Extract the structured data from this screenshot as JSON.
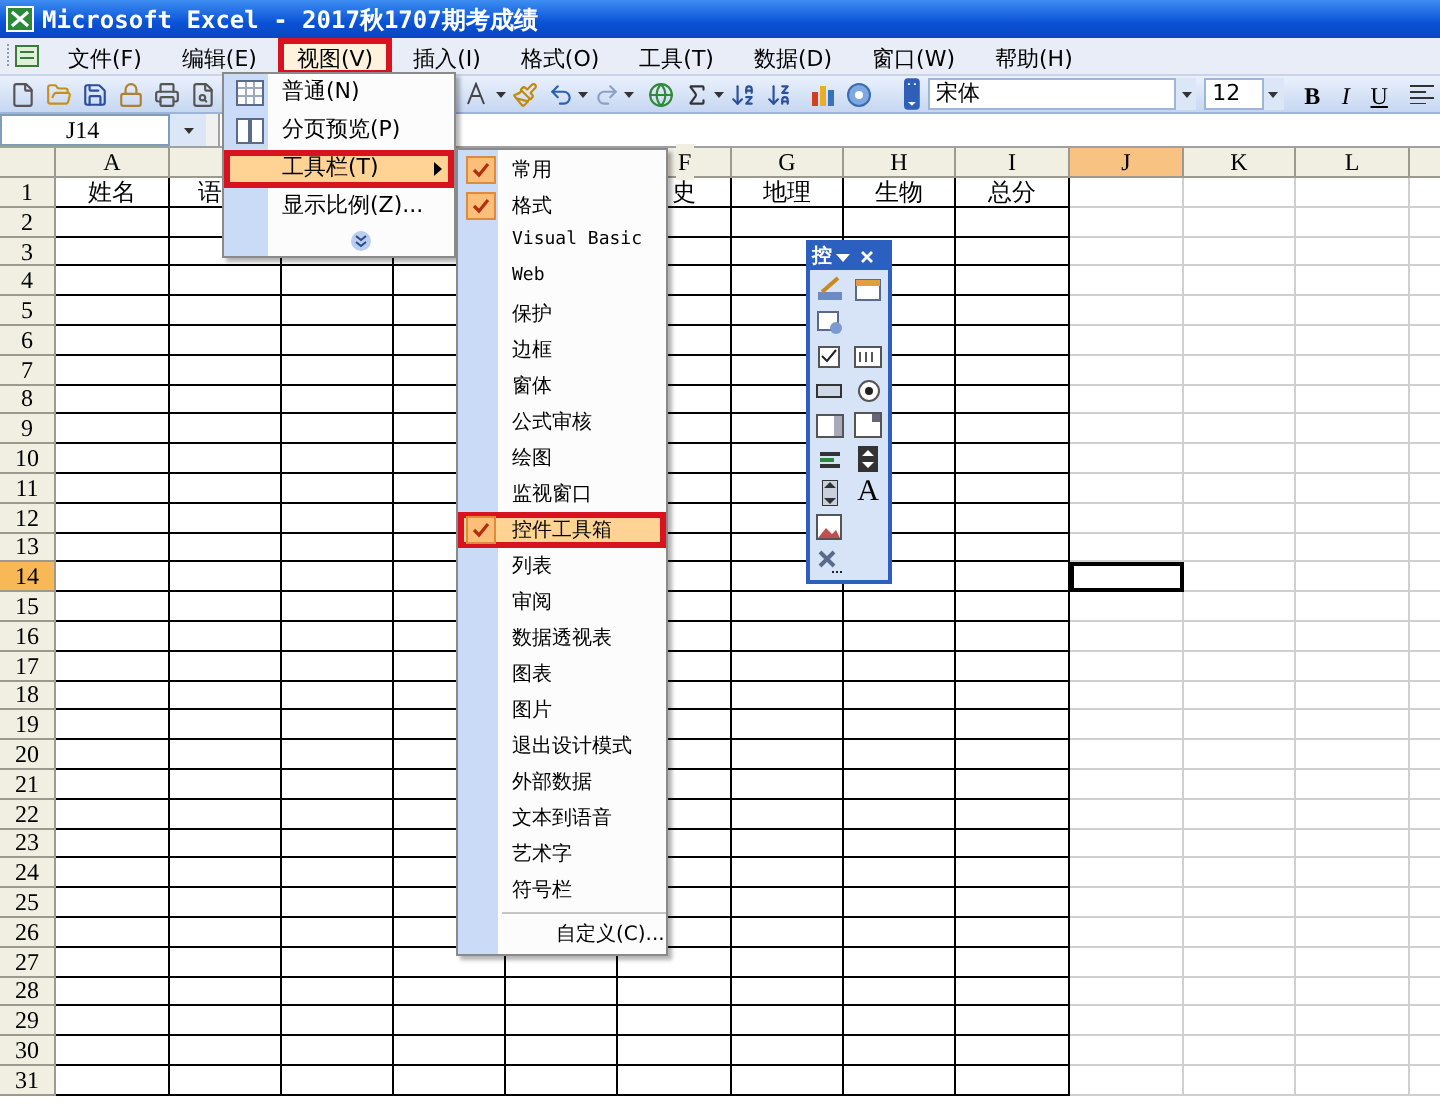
{
  "window": {
    "title": "Microsoft Excel - 2017秋1707期考成绩"
  },
  "menu_bar": [
    {
      "label": "文件(F)",
      "selected": false,
      "annotated": false
    },
    {
      "label": "编辑(E)",
      "selected": false,
      "annotated": false
    },
    {
      "label": "视图(V)",
      "selected": true,
      "annotated": true
    },
    {
      "label": "插入(I)",
      "selected": false,
      "annotated": false
    },
    {
      "label": "格式(O)",
      "selected": false,
      "annotated": false
    },
    {
      "label": "工具(T)",
      "selected": false,
      "annotated": false
    },
    {
      "label": "数据(D)",
      "selected": false,
      "annotated": false
    },
    {
      "label": "窗口(W)",
      "selected": false,
      "annotated": false
    },
    {
      "label": "帮助(H)",
      "selected": false,
      "annotated": false
    }
  ],
  "toolbar": {
    "font": "宋体",
    "font_size": "12",
    "format_buttons": [
      "B",
      "I",
      "U"
    ]
  },
  "name_box": "J14",
  "sheet": {
    "columns": [
      {
        "label": "A",
        "selected": false
      },
      {},
      {},
      {},
      {},
      {
        "label": "F",
        "selected": false
      },
      {
        "label": "G",
        "selected": false
      },
      {
        "label": "H",
        "selected": false
      },
      {
        "label": "I",
        "selected": false
      },
      {
        "label": "J",
        "selected": true
      },
      {
        "label": "K",
        "selected": false
      },
      {
        "label": "L",
        "selected": false
      }
    ],
    "rows": [
      {
        "label": "1",
        "selected": false,
        "cells": [
          {
            "text": "姓名"
          },
          {
            "text": "语"
          },
          null,
          null,
          null,
          {
            "text": "史"
          },
          {
            "text": "地理"
          },
          {
            "text": "生物"
          },
          {
            "text": "总分"
          }
        ]
      },
      {
        "label": "2",
        "selected": false
      },
      {
        "label": "3",
        "selected": false
      },
      {
        "label": "4",
        "selected": false
      },
      {
        "label": "5",
        "selected": false
      },
      {
        "label": "6",
        "selected": false
      },
      {
        "label": "7",
        "selected": false
      },
      {
        "label": "8",
        "selected": false
      },
      {
        "label": "9",
        "selected": false
      },
      {
        "label": "10",
        "selected": false
      },
      {
        "label": "11",
        "selected": false
      },
      {
        "label": "12",
        "selected": false
      },
      {
        "label": "13",
        "selected": false
      },
      {
        "label": "14",
        "selected": true
      },
      {
        "label": "15",
        "selected": false
      },
      {
        "label": "16",
        "selected": false
      },
      {
        "label": "17",
        "selected": false
      },
      {
        "label": "18",
        "selected": false
      },
      {
        "label": "19",
        "selected": false
      },
      {
        "label": "20",
        "selected": false
      },
      {
        "label": "21",
        "selected": false
      },
      {
        "label": "22",
        "selected": false
      },
      {
        "label": "23",
        "selected": false
      },
      {
        "label": "24",
        "selected": false
      },
      {
        "label": "25",
        "selected": false
      },
      {
        "label": "26",
        "selected": false
      },
      {
        "label": "27",
        "selected": false
      },
      {
        "label": "28",
        "selected": false
      },
      {
        "label": "29",
        "selected": false
      },
      {
        "label": "30",
        "selected": false
      },
      {
        "label": "31",
        "selected": false
      }
    ]
  },
  "view_menu": {
    "items": [
      {
        "kind": "item",
        "label": "普通(N)",
        "selected": false,
        "annotated": false
      },
      {
        "kind": "item",
        "label": "分页预览(P)",
        "selected": false,
        "annotated": false
      },
      {
        "kind": "submenu",
        "label": "工具栏(T)",
        "selected": true,
        "annotated": true
      },
      {
        "kind": "item",
        "label": "显示比例(Z)...",
        "selected": false,
        "annotated": false
      },
      {
        "kind": "expand"
      }
    ]
  },
  "toolbars_submenu": {
    "items": [
      {
        "kind": "toggle",
        "label": "常用",
        "checked": true,
        "selected": false,
        "annotated": false
      },
      {
        "kind": "toggle",
        "label": "格式",
        "checked": true,
        "selected": false,
        "annotated": false
      },
      {
        "kind": "toggle",
        "label": "Visual Basic",
        "checked": false,
        "selected": false,
        "annotated": false
      },
      {
        "kind": "toggle",
        "label": "Web",
        "checked": false,
        "selected": false,
        "annotated": false
      },
      {
        "kind": "toggle",
        "label": "保护",
        "checked": false,
        "selected": false,
        "annotated": false
      },
      {
        "kind": "toggle",
        "label": "边框",
        "checked": false,
        "selected": false,
        "annotated": false
      },
      {
        "kind": "toggle",
        "label": "窗体",
        "checked": false,
        "selected": false,
        "annotated": false
      },
      {
        "kind": "toggle",
        "label": "公式审核",
        "checked": false,
        "selected": false,
        "annotated": false
      },
      {
        "kind": "toggle",
        "label": "绘图",
        "checked": false,
        "selected": false,
        "annotated": false
      },
      {
        "kind": "toggle",
        "label": "监视窗口",
        "checked": false,
        "selected": false,
        "annotated": false
      },
      {
        "kind": "toggle",
        "label": "控件工具箱",
        "checked": true,
        "selected": true,
        "annotated": true
      },
      {
        "kind": "toggle",
        "label": "列表",
        "checked": false,
        "selected": false,
        "annotated": false
      },
      {
        "kind": "toggle",
        "label": "审阅",
        "checked": false,
        "selected": false,
        "annotated": false
      },
      {
        "kind": "toggle",
        "label": "数据透视表",
        "checked": false,
        "selected": false,
        "annotated": false
      },
      {
        "kind": "toggle",
        "label": "图表",
        "checked": false,
        "selected": false,
        "annotated": false
      },
      {
        "kind": "toggle",
        "label": "图片",
        "checked": false,
        "selected": false,
        "annotated": false
      },
      {
        "kind": "toggle",
        "label": "退出设计模式",
        "checked": false,
        "selected": false,
        "annotated": false
      },
      {
        "kind": "toggle",
        "label": "外部数据",
        "checked": false,
        "selected": false,
        "annotated": false
      },
      {
        "kind": "toggle",
        "label": "文本到语音",
        "checked": false,
        "selected": false,
        "annotated": false
      },
      {
        "kind": "toggle",
        "label": "艺术字",
        "checked": false,
        "selected": false,
        "annotated": false
      },
      {
        "kind": "toggle",
        "label": "符号栏",
        "checked": false,
        "selected": false,
        "annotated": false
      },
      {
        "kind": "command",
        "label": "自定义(C)...",
        "checked": false,
        "selected": false,
        "annotated": false
      }
    ]
  },
  "control_toolbox": {
    "title": "控",
    "label_tool": "A"
  }
}
